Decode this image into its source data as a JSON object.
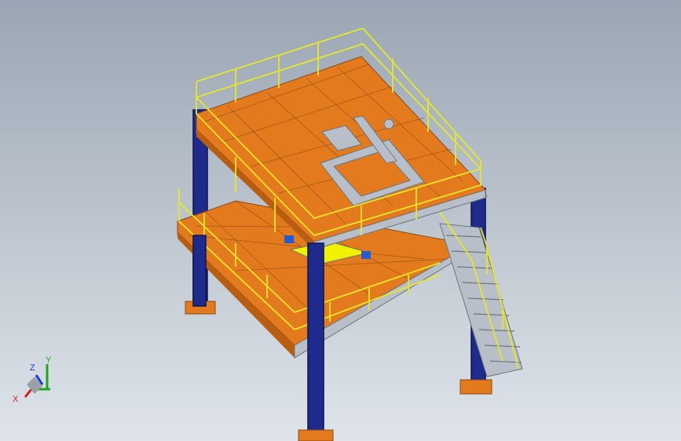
{
  "viewport": {
    "background_top": "#9aa6b3",
    "background_bottom": "#dfe4ea"
  },
  "colors": {
    "deck": "#e37a1d",
    "deck_dark": "#b95e10",
    "deck_line": "#8a4b14",
    "column": "#1e2a8c",
    "column_edge": "#0c1450",
    "railing": "#e6e62a",
    "frame": "#b8bfc8",
    "frame_dark": "#6d7580",
    "hatch": "#f0f000",
    "accent_blue": "#2a5ad0"
  },
  "triad": {
    "x_label": "X",
    "y_label": "Y",
    "z_label": "Z",
    "x_color": "#d81c1c",
    "y_color": "#1ca81c",
    "z_color": "#1c3ad8"
  }
}
